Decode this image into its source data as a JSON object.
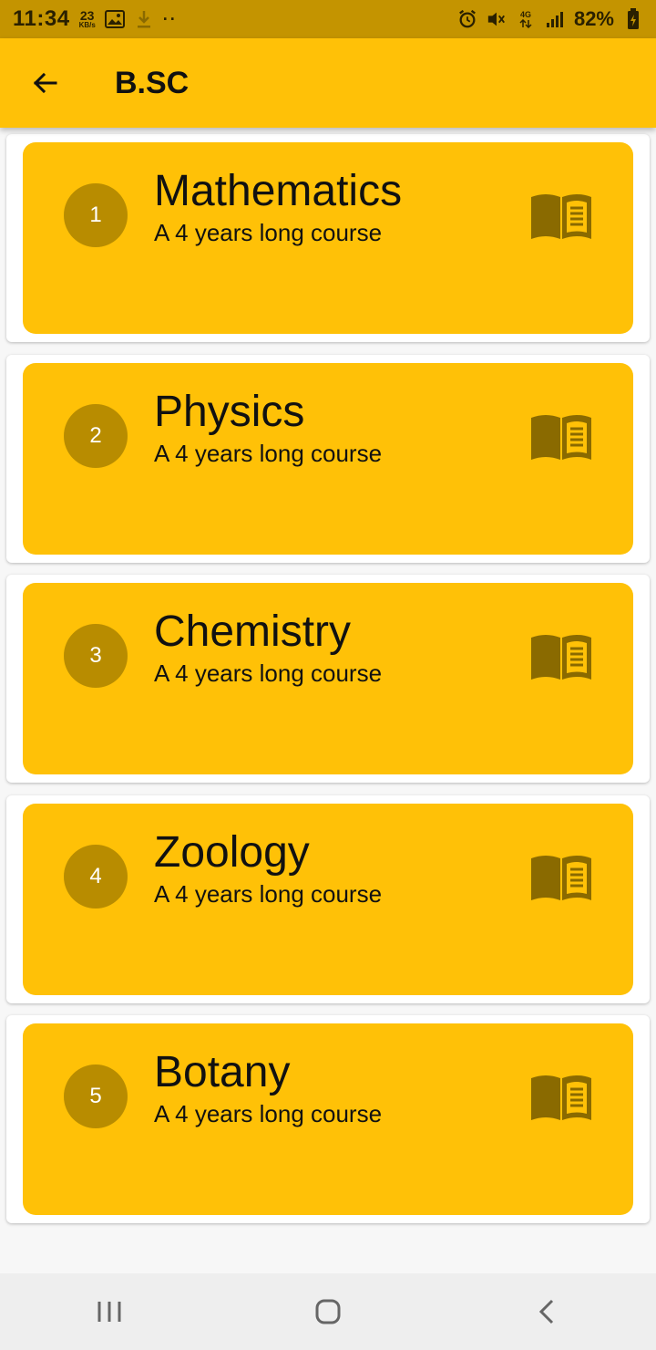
{
  "status_bar": {
    "time": "11:34",
    "speed_value": "23",
    "speed_unit": "KB/s",
    "extra": "··",
    "network": "4G",
    "battery": "82%"
  },
  "app_bar": {
    "title": "B.SC"
  },
  "courses": [
    {
      "number": "1",
      "title": "Mathematics",
      "subtitle": "A 4 years long course"
    },
    {
      "number": "2",
      "title": "Physics",
      "subtitle": "A 4 years long course"
    },
    {
      "number": "3",
      "title": "Chemistry",
      "subtitle": "A 4 years long course"
    },
    {
      "number": "4",
      "title": "Zoology",
      "subtitle": "A 4 years long course"
    },
    {
      "number": "5",
      "title": "Botany",
      "subtitle": "A 4 years long course"
    }
  ],
  "colors": {
    "primary": "#ffc107",
    "status_bar": "#c49400",
    "circle": "#b88c00",
    "icon": "#8a6a00"
  },
  "icons": {
    "back": "arrow-back-icon",
    "course": "book-icon"
  }
}
